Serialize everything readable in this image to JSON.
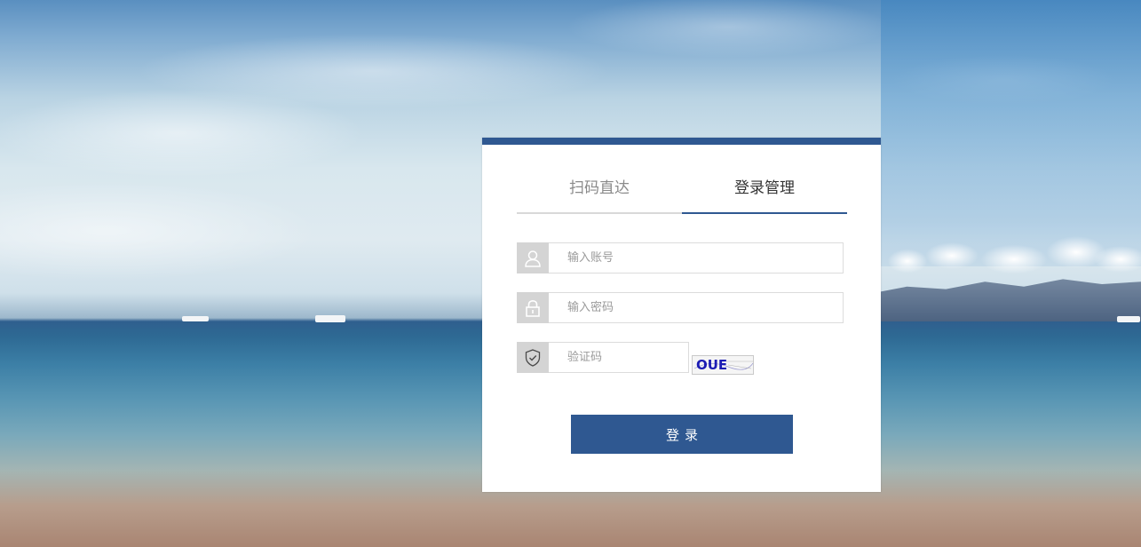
{
  "tabs": {
    "scan_label": "扫码直达",
    "login_label": "登录管理"
  },
  "form": {
    "account_placeholder": "输入账号",
    "password_placeholder": "输入密码",
    "captcha_placeholder": "验证码",
    "captcha_image_text": "OUE",
    "submit_label": "登录"
  },
  "colors": {
    "accent": "#2f5891",
    "icon_bg": "#d4d4d4"
  },
  "icons": {
    "account": "user-icon",
    "password": "lock-icon",
    "captcha": "shield-check-icon"
  }
}
